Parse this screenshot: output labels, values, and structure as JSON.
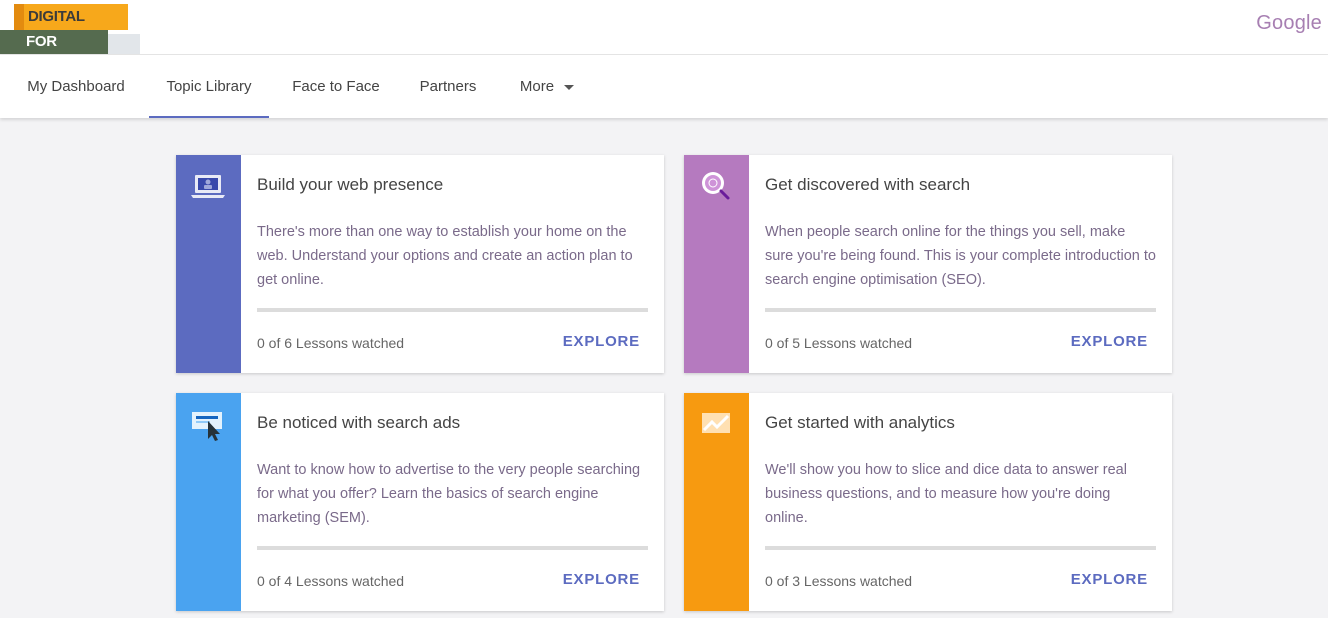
{
  "brand": {
    "logo_line1": "DIGITAL SKILLS",
    "logo_line2": "FOR AFRICA",
    "google_word": "Google",
    "colors": {
      "orange": "#f7a81b",
      "green": "#556b4f",
      "google_purple": "#a77fb2"
    }
  },
  "nav": {
    "items": [
      {
        "label": "My Dashboard",
        "active": false
      },
      {
        "label": "Topic Library",
        "active": true
      },
      {
        "label": "Face to Face",
        "active": false
      },
      {
        "label": "Partners",
        "active": false
      },
      {
        "label": "More",
        "active": false,
        "icon": "caret-down-icon"
      }
    ],
    "active_color": "#5c6bc0"
  },
  "cards": [
    {
      "title": "Build your web presence",
      "description": "There's more than one way to establish your home on the web. Understand your options and create an action plan to get online.",
      "progress_label": "0 of 6 Lessons watched",
      "progress_fraction": 0,
      "action": "EXPLORE",
      "color": "#5c6bc0",
      "icon": "laptop-icon"
    },
    {
      "title": "Get discovered with search",
      "description": "When people search online for the things you sell, make sure you're being found. This is your complete introduction to search engine optimisation (SEO).",
      "progress_label": "0 of 5 Lessons watched",
      "progress_fraction": 0,
      "action": "EXPLORE",
      "color": "#b57abf",
      "icon": "magnifier-icon"
    },
    {
      "title": "Be noticed with search ads",
      "description": "Want to know how to advertise to the very people searching for what you offer? Learn the basics of search engine marketing (SEM).",
      "progress_label": "0 of 4 Lessons watched",
      "progress_fraction": 0,
      "action": "EXPLORE",
      "color": "#4aa3f0",
      "icon": "ad-click-icon"
    },
    {
      "title": "Get started with analytics",
      "description": "We'll show you how to slice and dice data to answer real business questions, and to measure how you're doing online.",
      "progress_label": "0 of 3 Lessons watched",
      "progress_fraction": 0,
      "action": "EXPLORE",
      "color": "#f79a10",
      "icon": "chart-line-icon"
    }
  ]
}
